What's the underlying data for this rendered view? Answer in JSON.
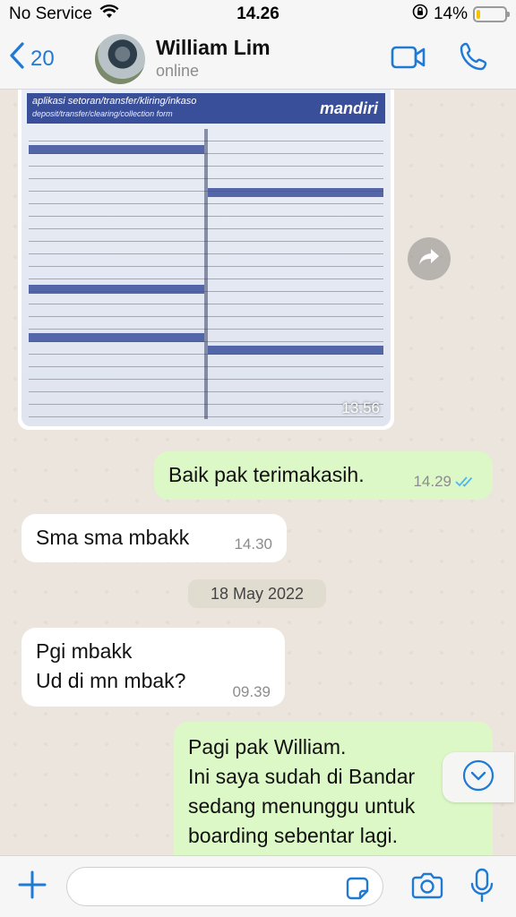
{
  "status_bar": {
    "carrier": "No Service",
    "time": "14.26",
    "battery": "14%",
    "battery_level": 0.14,
    "battery_color": "#f5c400"
  },
  "header": {
    "back_count": "20",
    "contact_name": "William Lim",
    "contact_status": "online",
    "accent_color": "#1f7ad6"
  },
  "messages": [
    {
      "type": "image",
      "direction": "incoming",
      "time": "13.56",
      "doc_title": "aplikasi setoran/transfer/kliring/inkaso",
      "doc_subtitle": "deposit/transfer/clearing/collection form",
      "doc_brand": "mandiri"
    },
    {
      "type": "text",
      "direction": "outgoing",
      "text": "Baik pak terimakasih.",
      "time": "14.29",
      "status": "read"
    },
    {
      "type": "text",
      "direction": "incoming",
      "text": "Sma sma mbakk",
      "time": "14.30"
    },
    {
      "type": "date",
      "text": "18 May 2022"
    },
    {
      "type": "text",
      "direction": "incoming",
      "lines": [
        "Pgi mbakk",
        "Ud di mn mbak?"
      ],
      "time": "09.39"
    },
    {
      "type": "text",
      "direction": "outgoing",
      "lines": [
        "Pagi pak William.",
        "Ini saya sudah di Bandar",
        "sedang menunggu untuk",
        "boarding sebentar lagi."
      ]
    }
  ],
  "input": {
    "placeholder": "",
    "value": ""
  },
  "icons": {
    "back": "chevron-left-icon",
    "video": "video-call-icon",
    "phone": "phone-icon",
    "forward": "forward-icon",
    "scroll": "chevron-down-icon",
    "plus": "plus-icon",
    "sticker": "sticker-icon",
    "camera": "camera-icon",
    "mic": "microphone-icon"
  },
  "colors": {
    "outgoing_bubble": "#dcf8c6",
    "incoming_bubble": "#ffffff",
    "read_ticks": "#4fb6ec",
    "chat_background": "#ece5dd"
  }
}
